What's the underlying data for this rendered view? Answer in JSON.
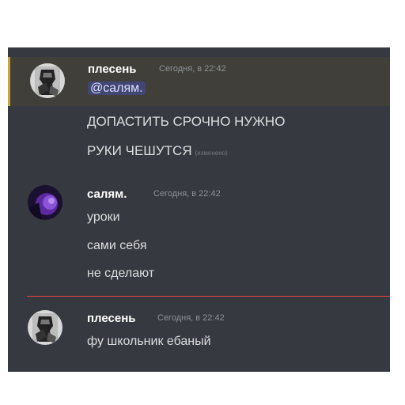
{
  "messages": [
    {
      "author": "плесень",
      "timestamp": "Сегодня, в 22:42",
      "mention": "@салям.",
      "lines": [
        "ДОПАСТИТЬ СРОЧНО НУЖНО",
        "РУКИ ЧЕШУТСЯ"
      ],
      "edited_label": "(изменено)"
    },
    {
      "author": "салям.",
      "timestamp": "Сегодня, в 22:42",
      "lines": [
        "уроки",
        "сами себя",
        "не сделают"
      ]
    },
    {
      "author": "плесень",
      "timestamp": "Сегодня, в 22:42",
      "lines": [
        "фу школьник ебаный"
      ]
    }
  ],
  "colors": {
    "background": "#36393f",
    "mention_highlight_bar": "#c9a53a",
    "new_messages_divider": "#ed4245"
  }
}
